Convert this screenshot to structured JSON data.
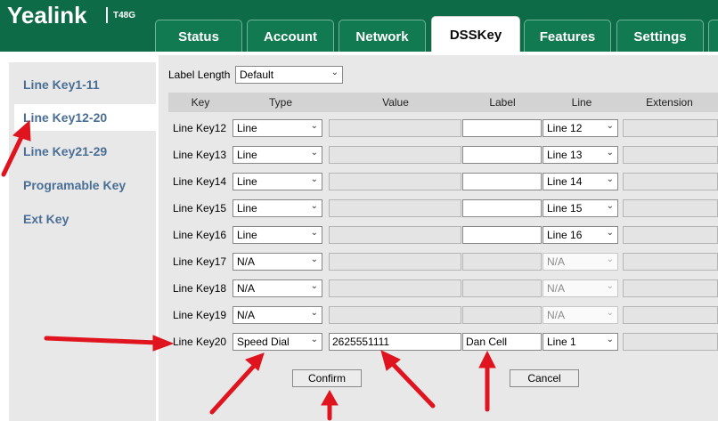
{
  "brand": {
    "logo": "Yealink",
    "model": "T48G"
  },
  "tabs": [
    {
      "label": "Status"
    },
    {
      "label": "Account"
    },
    {
      "label": "Network"
    },
    {
      "label": "DSSKey"
    },
    {
      "label": "Features"
    },
    {
      "label": "Settings"
    }
  ],
  "sidebar": {
    "items": [
      {
        "label": "Line Key1-11"
      },
      {
        "label": "Line Key12-20"
      },
      {
        "label": "Line Key21-29"
      },
      {
        "label": "Programable Key"
      },
      {
        "label": "Ext Key"
      }
    ]
  },
  "label_length": {
    "label": "Label Length",
    "value": "Default"
  },
  "table": {
    "headers": [
      "Key",
      "Type",
      "Value",
      "Label",
      "Line",
      "Extension"
    ],
    "rows": [
      {
        "key": "Line Key12",
        "type": "Line",
        "value": "",
        "label": "",
        "line": "Line 12",
        "extension": ""
      },
      {
        "key": "Line Key13",
        "type": "Line",
        "value": "",
        "label": "",
        "line": "Line 13",
        "extension": ""
      },
      {
        "key": "Line Key14",
        "type": "Line",
        "value": "",
        "label": "",
        "line": "Line 14",
        "extension": ""
      },
      {
        "key": "Line Key15",
        "type": "Line",
        "value": "",
        "label": "",
        "line": "Line 15",
        "extension": ""
      },
      {
        "key": "Line Key16",
        "type": "Line",
        "value": "",
        "label": "",
        "line": "Line 16",
        "extension": ""
      },
      {
        "key": "Line Key17",
        "type": "N/A",
        "value": "",
        "label": "",
        "line": "N/A",
        "extension": ""
      },
      {
        "key": "Line Key18",
        "type": "N/A",
        "value": "",
        "label": "",
        "line": "N/A",
        "extension": ""
      },
      {
        "key": "Line Key19",
        "type": "N/A",
        "value": "",
        "label": "",
        "line": "N/A",
        "extension": ""
      },
      {
        "key": "Line Key20",
        "type": "Speed Dial",
        "value": "2625551111",
        "label": "Dan Cell",
        "line": "Line 1",
        "extension": ""
      }
    ]
  },
  "buttons": {
    "confirm": "Confirm",
    "cancel": "Cancel"
  },
  "colors": {
    "header": "#0e6b47",
    "tab": "#127a50",
    "sidebar_text": "#4a6f96",
    "arrow": "#e0141e"
  }
}
